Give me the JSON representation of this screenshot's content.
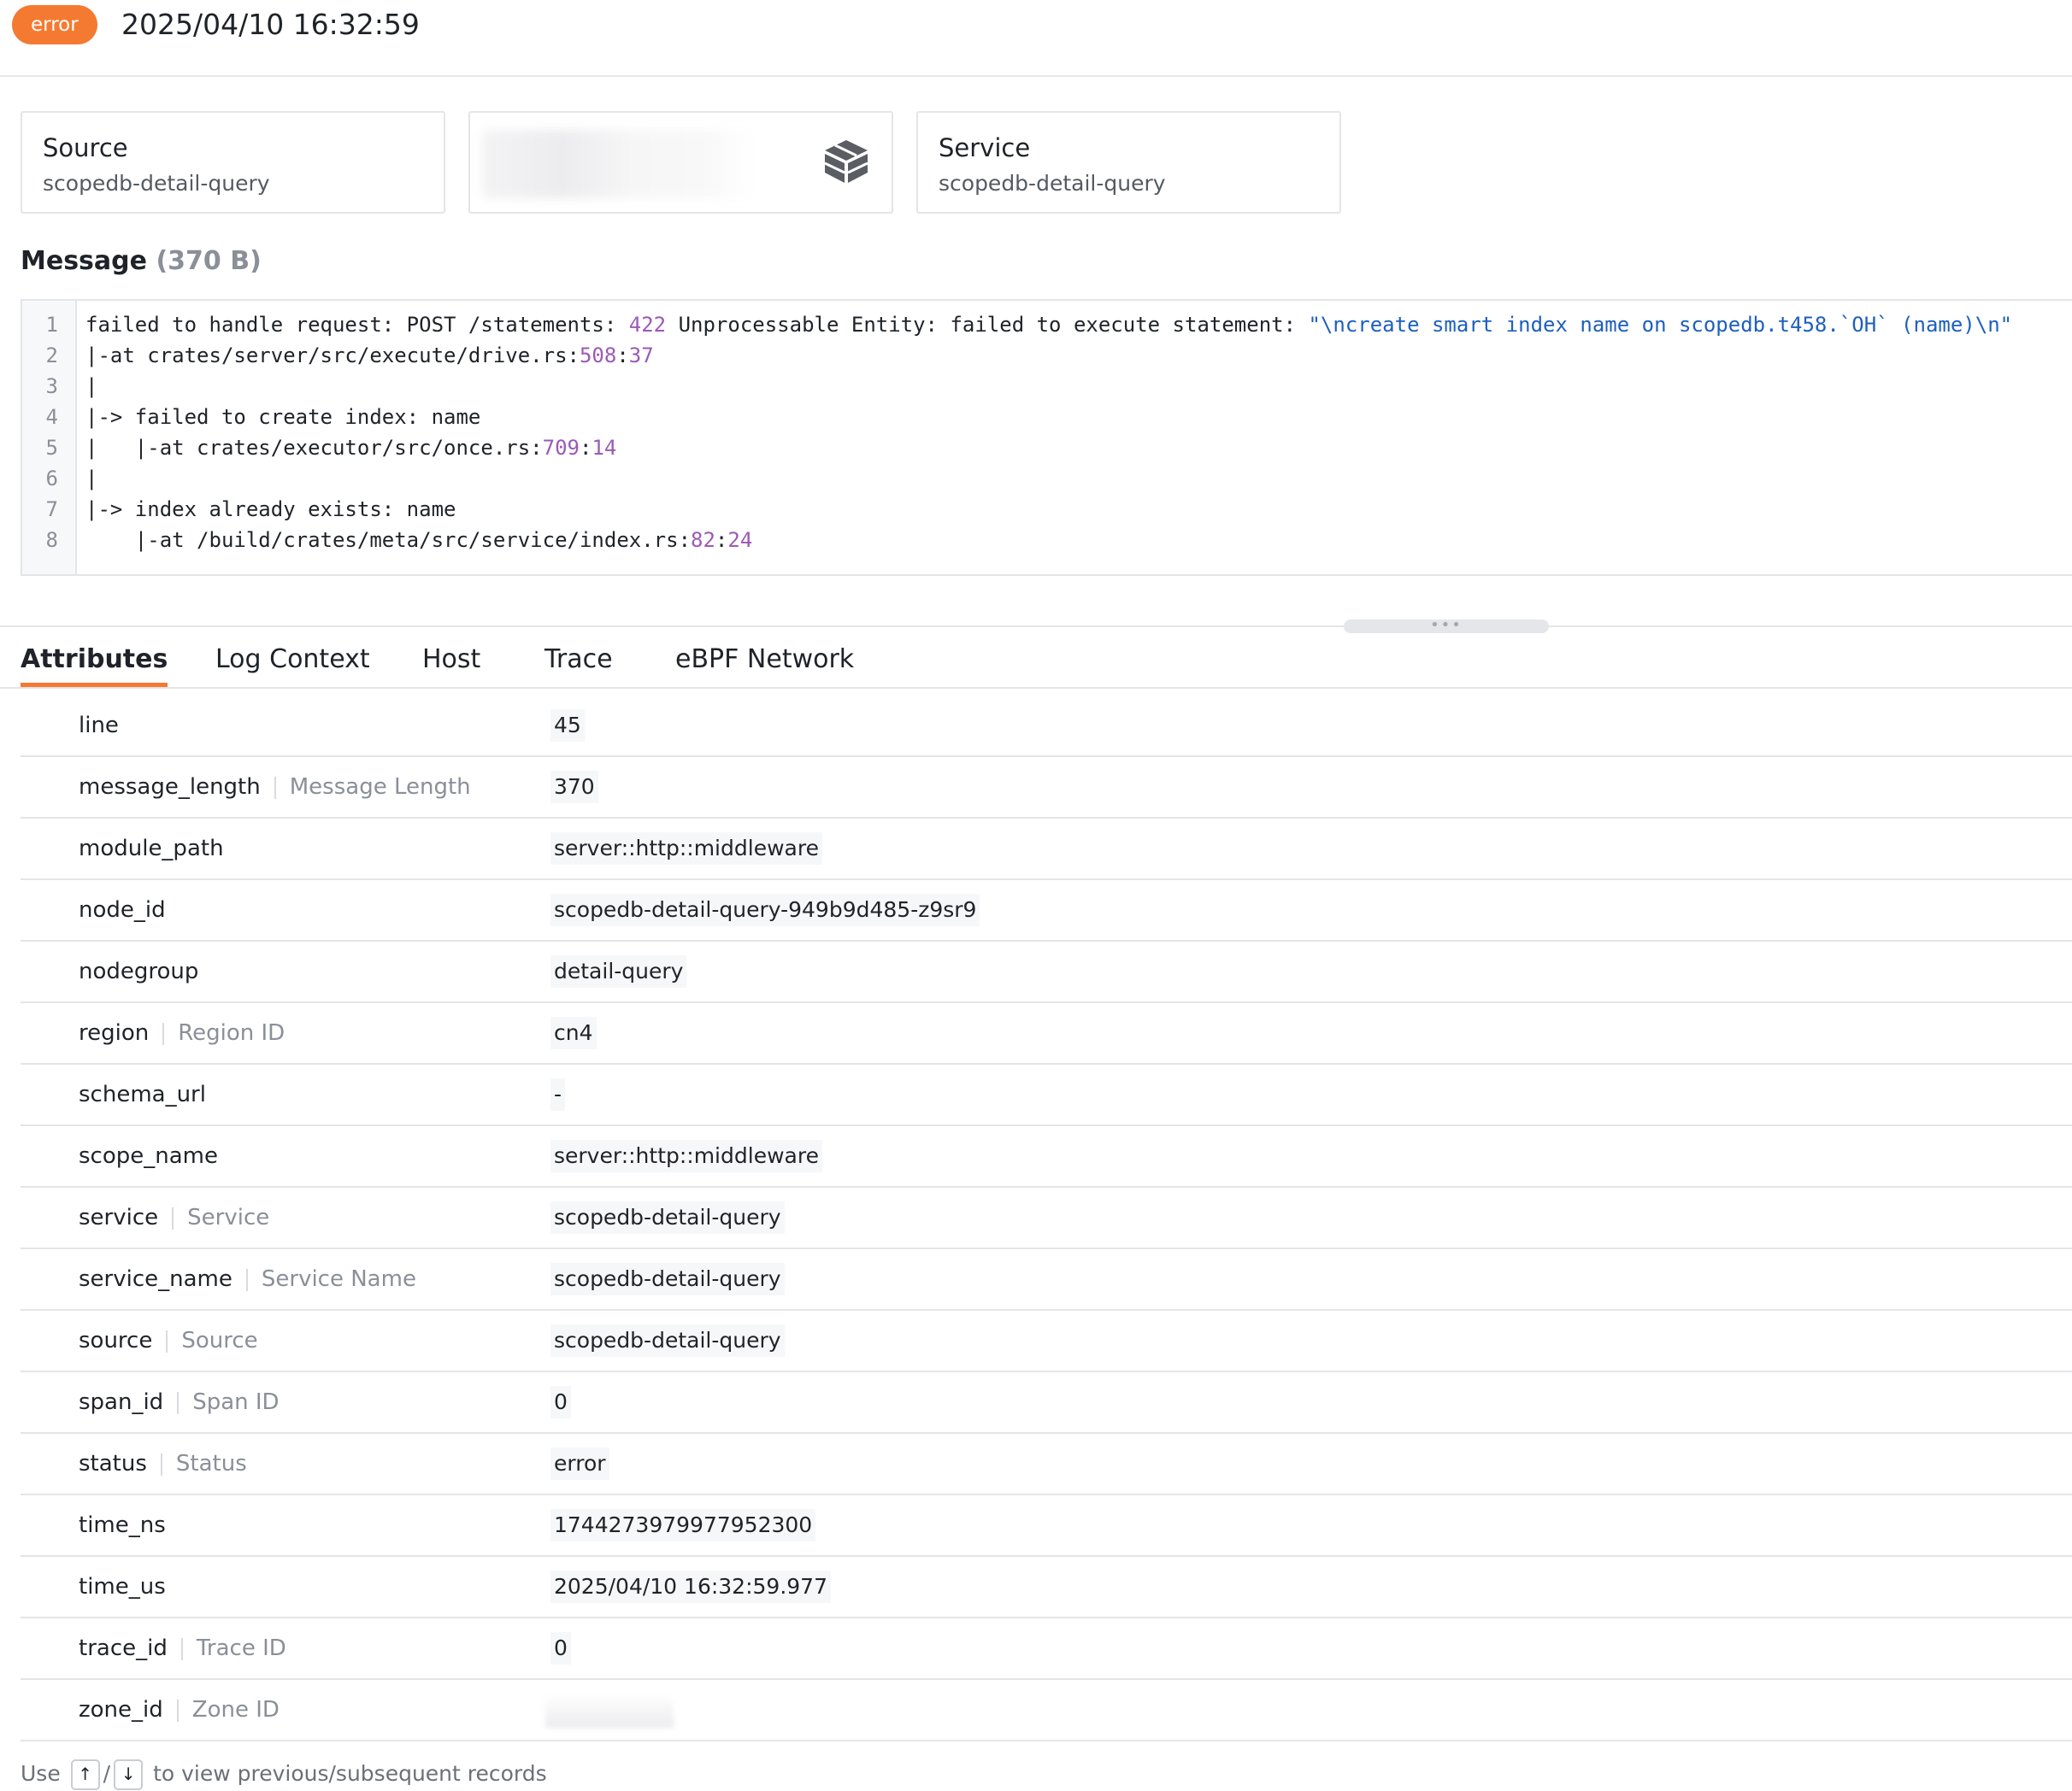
{
  "header": {
    "status_badge": "error",
    "timestamp": "2025/04/10 16:32:59"
  },
  "cards": {
    "source": {
      "title": "Source",
      "value": "scopedb-detail-query"
    },
    "middle": {
      "icon": "cube-stack-icon"
    },
    "service": {
      "title": "Service",
      "value": "scopedb-detail-query"
    }
  },
  "message": {
    "title": "Message",
    "size": "(370 B)",
    "lines": [
      {
        "num": "1",
        "parts": [
          {
            "t": "failed to handle request: POST /statements: ",
            "c": "plain"
          },
          {
            "t": "422",
            "c": "num"
          },
          {
            "t": " Unprocessable Entity: failed to execute statement: ",
            "c": "plain"
          },
          {
            "t": "\"\\ncreate smart index name on scopedb.t458.`OH` (name)\\n\"",
            "c": "str"
          }
        ]
      },
      {
        "num": "2",
        "parts": [
          {
            "t": "|-at crates/server/src/execute/drive.rs:",
            "c": "plain"
          },
          {
            "t": "508",
            "c": "num"
          },
          {
            "t": ":",
            "c": "plain"
          },
          {
            "t": "37",
            "c": "num"
          }
        ]
      },
      {
        "num": "3",
        "parts": [
          {
            "t": "|",
            "c": "plain"
          }
        ]
      },
      {
        "num": "4",
        "parts": [
          {
            "t": "|-> failed to create index: name",
            "c": "plain"
          }
        ]
      },
      {
        "num": "5",
        "parts": [
          {
            "t": "|   |-at crates/executor/src/once.rs:",
            "c": "plain"
          },
          {
            "t": "709",
            "c": "num"
          },
          {
            "t": ":",
            "c": "plain"
          },
          {
            "t": "14",
            "c": "num"
          }
        ]
      },
      {
        "num": "6",
        "parts": [
          {
            "t": "|",
            "c": "plain"
          }
        ]
      },
      {
        "num": "7",
        "parts": [
          {
            "t": "|-> index already exists: name",
            "c": "plain"
          }
        ]
      },
      {
        "num": "8",
        "parts": [
          {
            "t": "    |-at /build/crates/meta/src/service/index.rs:",
            "c": "plain"
          },
          {
            "t": "82",
            "c": "num"
          },
          {
            "t": ":",
            "c": "plain"
          },
          {
            "t": "24",
            "c": "num"
          }
        ]
      }
    ]
  },
  "tabs": [
    {
      "label": "Attributes",
      "active": true
    },
    {
      "label": "Log Context",
      "active": false
    },
    {
      "label": "Host",
      "active": false
    },
    {
      "label": "Trace",
      "active": false
    },
    {
      "label": "eBPF Network",
      "active": false
    }
  ],
  "attributes": [
    {
      "key": "line",
      "alias": "",
      "value": "45"
    },
    {
      "key": "message_length",
      "alias": "Message Length",
      "value": "370"
    },
    {
      "key": "module_path",
      "alias": "",
      "value": "server::http::middleware"
    },
    {
      "key": "node_id",
      "alias": "",
      "value": "scopedb-detail-query-949b9d485-z9sr9"
    },
    {
      "key": "nodegroup",
      "alias": "",
      "value": "detail-query"
    },
    {
      "key": "region",
      "alias": "Region ID",
      "value": "cn4"
    },
    {
      "key": "schema_url",
      "alias": "",
      "value": "-"
    },
    {
      "key": "scope_name",
      "alias": "",
      "value": "server::http::middleware"
    },
    {
      "key": "service",
      "alias": "Service",
      "value": "scopedb-detail-query"
    },
    {
      "key": "service_name",
      "alias": "Service Name",
      "value": "scopedb-detail-query"
    },
    {
      "key": "source",
      "alias": "Source",
      "value": "scopedb-detail-query"
    },
    {
      "key": "span_id",
      "alias": "Span ID",
      "value": "0"
    },
    {
      "key": "status",
      "alias": "Status",
      "value": "error"
    },
    {
      "key": "time_ns",
      "alias": "",
      "value": "1744273979977952300"
    },
    {
      "key": "time_us",
      "alias": "",
      "value": "2025/04/10 16:32:59.977"
    },
    {
      "key": "trace_id",
      "alias": "Trace ID",
      "value": "0"
    },
    {
      "key": "zone_id",
      "alias": "Zone ID",
      "value": "",
      "redacted": true
    }
  ],
  "footer": {
    "prefix": "Use",
    "key_up": "↑",
    "slash": "/",
    "key_down": "↓",
    "suffix": "to view previous/subsequent records"
  },
  "colors": {
    "accent": "#f47a31",
    "number": "#9b59b6",
    "string": "#1d5fbf"
  }
}
